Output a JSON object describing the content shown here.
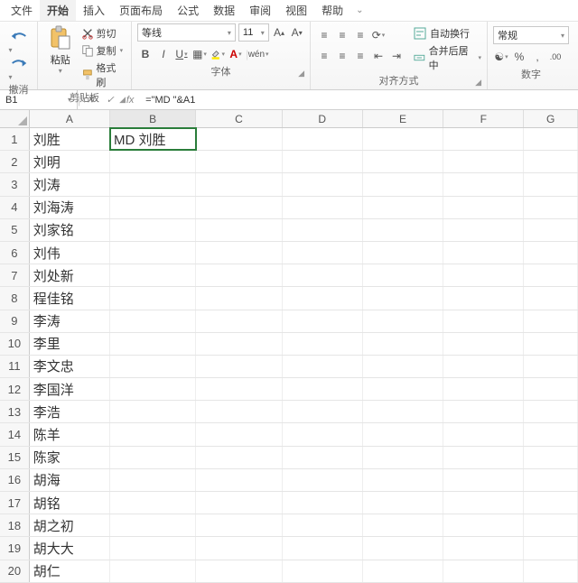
{
  "menu": {
    "file": "文件",
    "start": "开始",
    "insert": "插入",
    "layout": "页面布局",
    "formula": "公式",
    "data": "数据",
    "review": "审阅",
    "view": "视图",
    "help": "帮助"
  },
  "ribbon": {
    "undo_group": "撤消",
    "clip": {
      "paste": "粘贴",
      "cut": "剪切",
      "copy": "复制",
      "brush": "格式刷",
      "label": "剪贴板"
    },
    "font": {
      "name": "等线",
      "size": "11",
      "label": "字体"
    },
    "align": {
      "wrap": "自动换行",
      "merge": "合并后居中",
      "label": "对齐方式"
    },
    "number": {
      "format": "常规",
      "label": "数字"
    }
  },
  "fbar": {
    "name": "B1",
    "check": "✓",
    "cancel": "✕",
    "formula": "=\"MD \"&A1"
  },
  "cols": [
    "A",
    "B",
    "C",
    "D",
    "E",
    "F",
    "G"
  ],
  "rows": [
    {
      "n": "1",
      "A": "刘胜",
      "B": "MD 刘胜"
    },
    {
      "n": "2",
      "A": "刘明"
    },
    {
      "n": "3",
      "A": "刘涛"
    },
    {
      "n": "4",
      "A": "刘海涛"
    },
    {
      "n": "5",
      "A": "刘家铭"
    },
    {
      "n": "6",
      "A": "刘伟"
    },
    {
      "n": "7",
      "A": "刘处新"
    },
    {
      "n": "8",
      "A": "程佳铭"
    },
    {
      "n": "9",
      "A": "李涛"
    },
    {
      "n": "10",
      "A": "李里"
    },
    {
      "n": "11",
      "A": "李文忠"
    },
    {
      "n": "12",
      "A": "李国洋"
    },
    {
      "n": "13",
      "A": "李浩"
    },
    {
      "n": "14",
      "A": "陈羊"
    },
    {
      "n": "15",
      "A": "陈家"
    },
    {
      "n": "16",
      "A": "胡海"
    },
    {
      "n": "17",
      "A": "胡铭"
    },
    {
      "n": "18",
      "A": "胡之初"
    },
    {
      "n": "19",
      "A": "胡大大"
    },
    {
      "n": "20",
      "A": "胡仁"
    }
  ]
}
